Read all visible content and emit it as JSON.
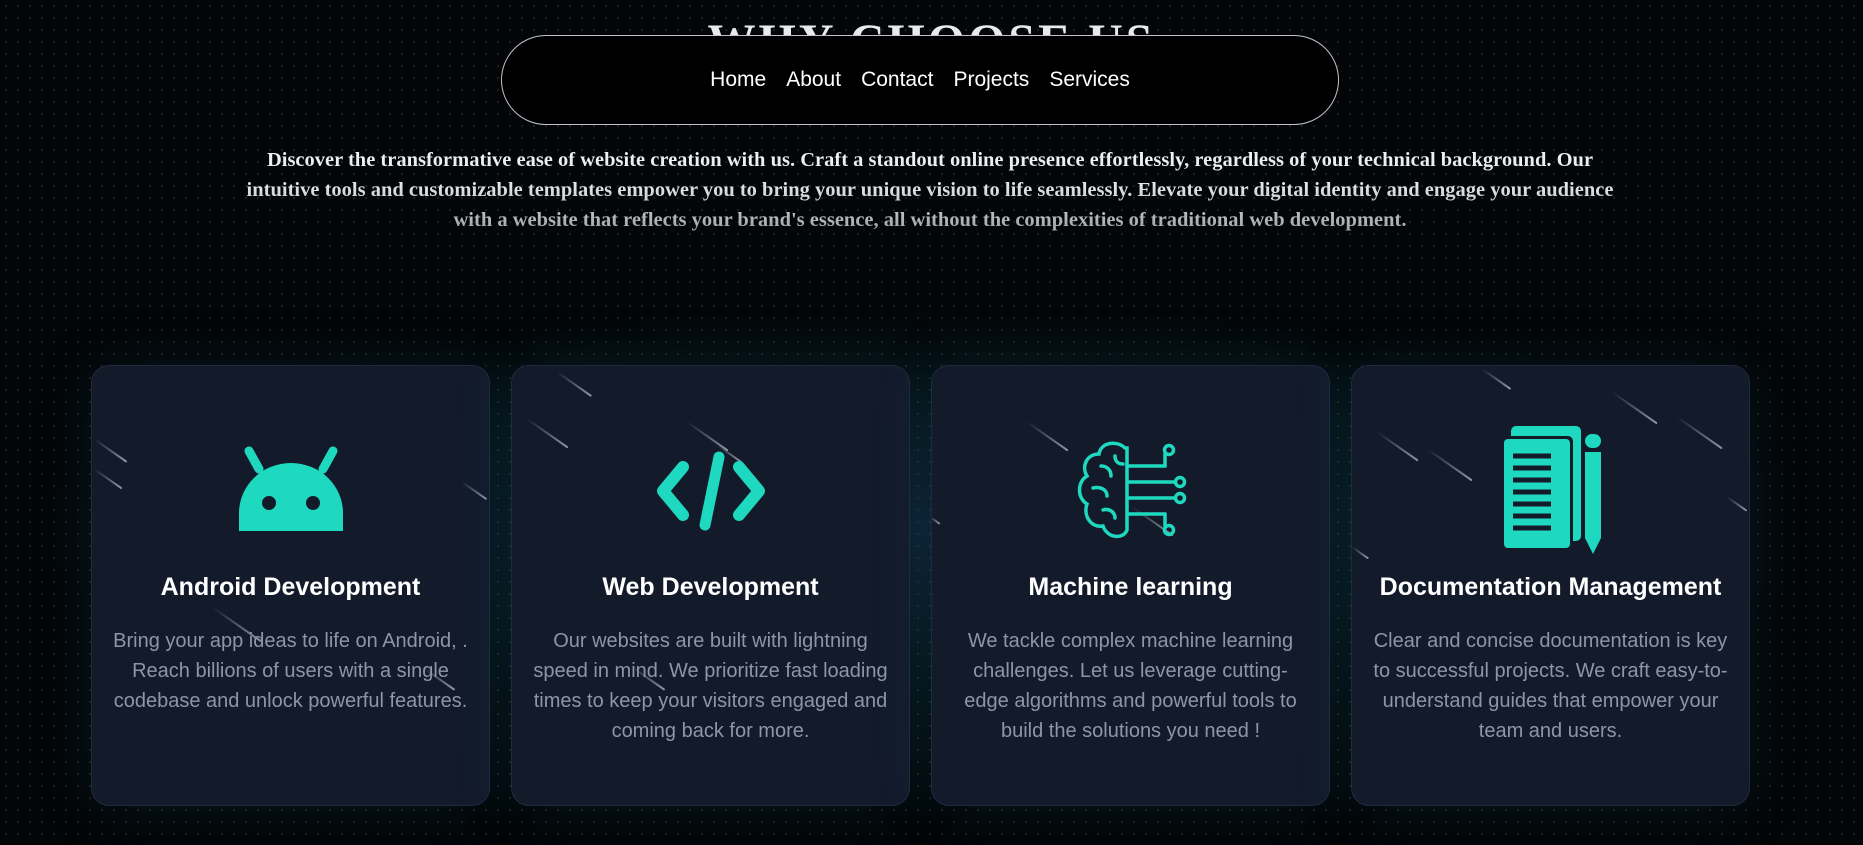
{
  "section": {
    "title": "WHY CHOOSE US"
  },
  "nav": {
    "items": [
      {
        "label": "Home"
      },
      {
        "label": "About"
      },
      {
        "label": "Contact"
      },
      {
        "label": "Projects"
      },
      {
        "label": "Services"
      }
    ]
  },
  "intro": {
    "text": "Discover the transformative ease of website creation with us. Craft a standout online presence effortlessly, regardless of your technical background. Our intuitive tools and customizable templates empower you to bring your unique vision to life seamlessly. Elevate your digital identity and engage your audience with a website that reflects your brand's essence, all without the complexities of traditional web development."
  },
  "cards": [
    {
      "icon": "android-icon",
      "title": "Android Development",
      "text": "Bring your app ideas to life on Android, . Reach billions of users with a single codebase and unlock powerful features."
    },
    {
      "icon": "code-icon",
      "title": "Web Development",
      "text": "Our websites are built with lightning speed in mind. We prioritize fast loading times to keep your visitors engaged and coming back for more."
    },
    {
      "icon": "brain-circuit-icon",
      "title": "Machine learning",
      "text": "We tackle complex machine learning challenges. Let us leverage cutting-edge algorithms and powerful tools to build the solutions you need !"
    },
    {
      "icon": "documents-pencil-icon",
      "title": "Documentation Management",
      "text": "Clear and concise documentation is key to successful projects. We craft easy-to-understand guides that empower your team and users."
    }
  ],
  "colors": {
    "accent": "#1fd8c0",
    "background": "#030507",
    "card": "#131b2b",
    "card_text": "#8d96a5"
  }
}
